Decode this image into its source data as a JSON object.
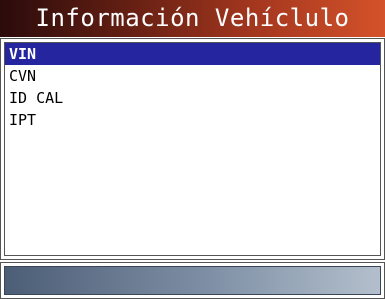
{
  "header": {
    "title": "Información Vehíclulo"
  },
  "menu": {
    "items": [
      {
        "label": "VIN",
        "selected": true
      },
      {
        "label": "CVN",
        "selected": false
      },
      {
        "label": "ID CAL",
        "selected": false
      },
      {
        "label": "IPT",
        "selected": false
      }
    ]
  },
  "colors": {
    "selection": "#2525a0",
    "title_gradient_start": "#2b0b0b",
    "title_gradient_end": "#d5522a",
    "status_gradient_start": "#4c5d76",
    "status_gradient_end": "#b3bfcc"
  }
}
